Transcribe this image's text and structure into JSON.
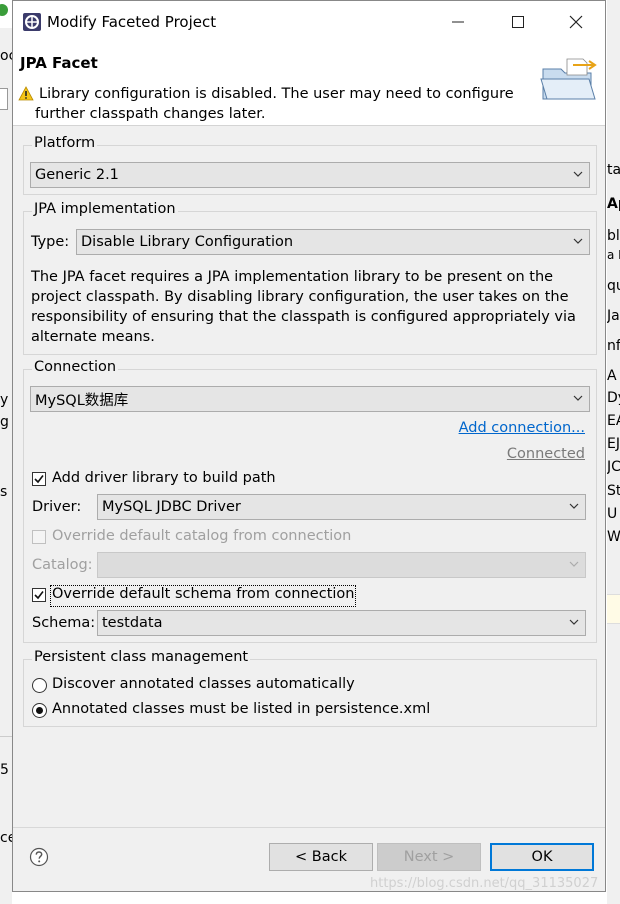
{
  "window": {
    "title": "Modify Faceted Project"
  },
  "header": {
    "facet_title": "JPA Facet",
    "warning_line1": "Library configuration is disabled. The user may need to configure",
    "warning_line2": "further classpath changes later."
  },
  "platform": {
    "group_label": "Platform",
    "value": "Generic 2.1"
  },
  "jpa_impl": {
    "group_label": "JPA implementation",
    "type_label": "Type:",
    "type_value": "Disable Library Configuration",
    "description": [
      "The JPA facet requires a JPA implementation library to be present on the",
      "project classpath. By disabling library configuration, the user takes on the",
      "responsibility of ensuring that the classpath is configured appropriately via",
      "alternate means."
    ]
  },
  "connection": {
    "group_label": "Connection",
    "value": "MySQL数据库",
    "add_link": "Add connection...",
    "status_link": "Connected",
    "add_driver_label": "Add driver library to build path",
    "add_driver_checked": true,
    "driver_label": "Driver:",
    "driver_value": "MySQL JDBC Driver",
    "override_catalog_label": "Override default catalog from connection",
    "override_catalog_checked": false,
    "catalog_label": "Catalog:",
    "catalog_value": "",
    "override_schema_label": "Override default schema from connection",
    "override_schema_checked": true,
    "schema_label": "Schema:",
    "schema_value": "testdata"
  },
  "persistent": {
    "group_label": "Persistent class management",
    "option_discover": "Discover annotated classes automatically",
    "option_listed": "Annotated classes must be listed in persistence.xml",
    "selected": "option_listed"
  },
  "buttons": {
    "back": "< Back",
    "next": "Next >",
    "ok": "OK"
  },
  "watermark": "https://blog.csdn.net/qq_31135027",
  "background": {
    "left": [
      "oc",
      "y",
      "g",
      "s",
      "5",
      "ce"
    ],
    "right": [
      "ta",
      "Ap",
      "bl",
      "a B",
      "qu",
      "Ja",
      "nfl",
      "A",
      "Dy",
      "EA",
      "EJ",
      "JC",
      "St",
      "U",
      "W"
    ]
  }
}
